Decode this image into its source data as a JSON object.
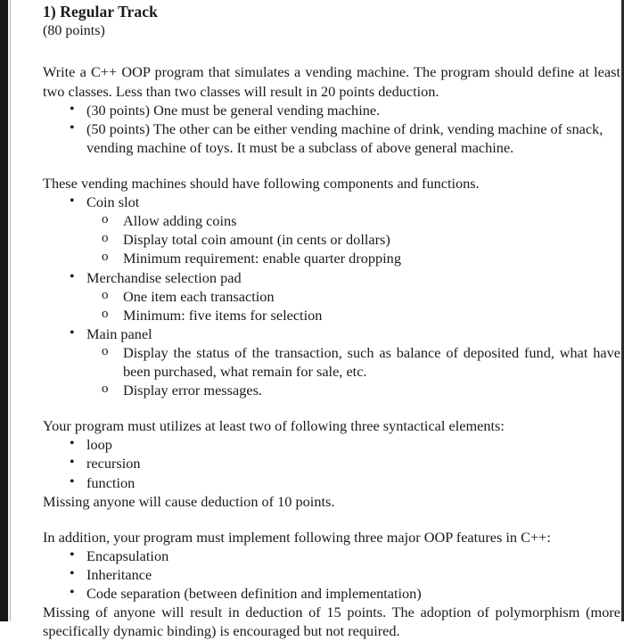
{
  "document": {
    "heading": "1) Regular Track",
    "points_line": "(80 points)",
    "intro_paragraph": "Write a C++ OOP program that simulates a vending machine. The program should define at least two classes. Less than two classes will result in 20 points deduction.",
    "intro_bullets": [
      "(30 points) One must be general vending machine.",
      "(50 points) The other can be either vending machine of drink, vending machine of snack, vending machine of toys. It must be a subclass of above general machine."
    ],
    "components_lead": "These vending machines should have following components and functions.",
    "components": [
      {
        "label": "Coin slot",
        "sub_items": [
          "Allow adding coins",
          "Display total coin amount (in cents or dollars)",
          "Minimum requirement: enable quarter dropping"
        ]
      },
      {
        "label": "Merchandise selection pad",
        "sub_items": [
          "One item each transaction",
          "Minimum: five items for selection"
        ]
      },
      {
        "label": "Main panel",
        "sub_items": [
          "Display the status of the transaction, such as balance of deposited fund, what have been purchased, what remain for sale, etc.",
          "Display error messages."
        ]
      }
    ],
    "syntactical_lead": "Your program must utilizes at least two of following three syntactical elements:",
    "syntactical_elements": [
      "loop",
      "recursion",
      "function"
    ],
    "syntactical_penalty": "Missing anyone will cause deduction of 10 points.",
    "oop_lead": "In addition, your program must implement following three major OOP features in C++:",
    "oop_features": [
      "Encapsulation",
      "Inheritance",
      "Code separation (between definition and implementation)"
    ],
    "oop_penalty": "Missing of anyone will result in deduction of 15 points. The adoption of polymorphism (more specifically dynamic binding) is encouraged but not required."
  },
  "glyphs": {
    "bullet_filled": "•",
    "bullet_hollow": "o"
  }
}
